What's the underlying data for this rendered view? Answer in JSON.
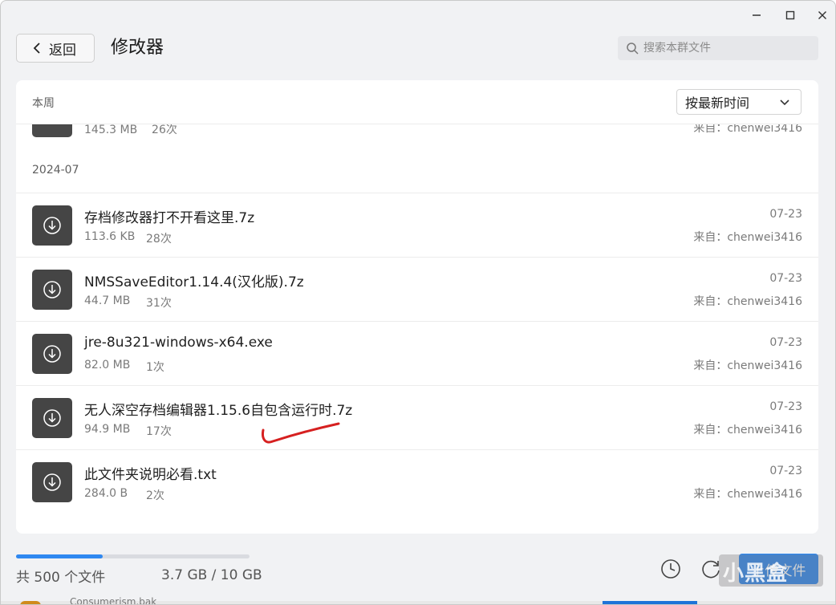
{
  "window": {
    "minimize_label": "—",
    "maximize_label": "□",
    "close_label": "✕"
  },
  "header": {
    "back_label": "返回",
    "title": "修改器",
    "search_placeholder": "搜索本群文件"
  },
  "list": {
    "section_label": "本周",
    "sort_value": "按最新时间",
    "partial_row": {
      "size": "145.3 MB",
      "count": "26次",
      "from": "来自：chenwei3416"
    },
    "date_group": "2024-07",
    "files": [
      {
        "name": "存档修改器打不开看这里.7z",
        "size": "113.6 KB",
        "count": "28次",
        "date": "07-23",
        "from": "来自：chenwei3416"
      },
      {
        "name": "NMSSaveEditor1.14.4(汉化版).7z",
        "size": "44.7 MB",
        "count": "31次",
        "date": "07-23",
        "from": "来自：chenwei3416"
      },
      {
        "name": "jre-8u321-windows-x64.exe",
        "size": "82.0 MB",
        "count": "1次",
        "date": "07-23",
        "from": "来自：chenwei3416"
      },
      {
        "name": "无人深空存档编辑器1.15.6自包含运行时.7z",
        "size": "94.9 MB",
        "count": "17次",
        "date": "07-23",
        "from": "来自：chenwei3416"
      },
      {
        "name": "此文件夹说明必看.txt",
        "size": "284.0 B",
        "count": "2次",
        "date": "07-23",
        "from": "来自：chenwei3416"
      }
    ]
  },
  "footer": {
    "progress_percent": 37,
    "file_total": "共 500 个文件",
    "storage": "3.7 GB / 10 GB",
    "upload_label": "上传文件",
    "watermark": "小黑盒"
  },
  "taskbar": {
    "partial_text": "Consumerism.bak"
  },
  "colors": {
    "accent": "#2f88f0",
    "annotation": "#d62020"
  }
}
